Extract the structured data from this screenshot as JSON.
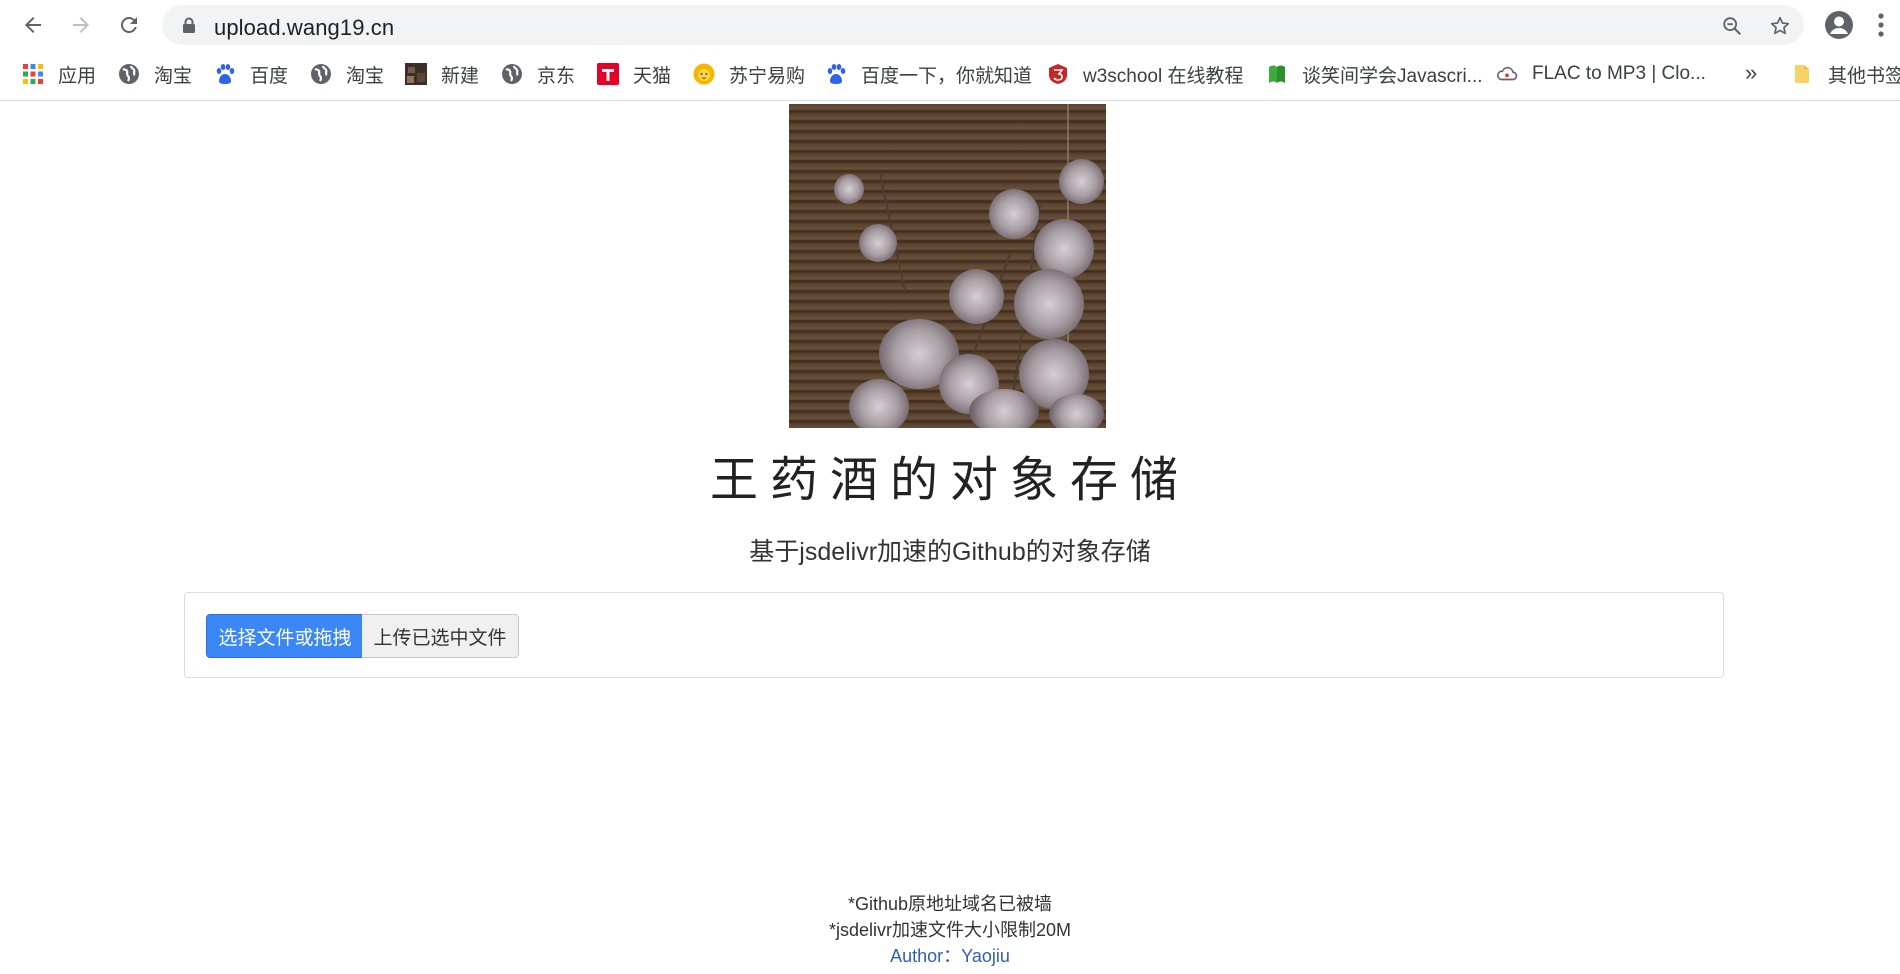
{
  "browser": {
    "url": "upload.wang19.cn",
    "bookmarks": [
      {
        "label": "应用",
        "icon": "apps-grid-icon"
      },
      {
        "label": "淘宝",
        "icon": "globe-icon"
      },
      {
        "label": "百度",
        "icon": "baidu-paw-icon"
      },
      {
        "label": "淘宝",
        "icon": "globe-icon"
      },
      {
        "label": "新建",
        "icon": "image-thumbnail-icon"
      },
      {
        "label": "京东",
        "icon": "globe-icon"
      },
      {
        "label": "天猫",
        "icon": "tmall-icon"
      },
      {
        "label": "苏宁易购",
        "icon": "suning-lion-icon"
      },
      {
        "label": "百度一下，你就知道",
        "icon": "baidu-paw-icon"
      },
      {
        "label": "w3school 在线教程",
        "icon": "w3school-icon"
      },
      {
        "label": "谈笑间学会Javascri...",
        "icon": "green-book-icon"
      },
      {
        "label": "FLAC to MP3 | Clo...",
        "icon": "cloud-icon"
      }
    ],
    "more_label": "»",
    "other_bookmarks": "其他书签"
  },
  "page": {
    "title": "王药酒的对象存储",
    "subtitle": "基于jsdelivr加速的Github的对象存储",
    "choose_button": "选择文件或拖拽",
    "upload_button": "上传已选中文件",
    "footer": {
      "note1": "*Github原地址域名已被墙",
      "note2": "*jsdelivr加速文件大小限制20M",
      "author": "Author：Yaojiu"
    }
  },
  "colors": {
    "primary": "#3a87f5",
    "link": "#2f5fb3"
  }
}
